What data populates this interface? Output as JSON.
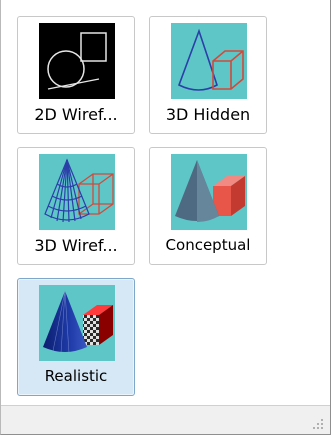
{
  "styles": [
    {
      "label": "2D Wiref..."
    },
    {
      "label": "3D Hidden"
    },
    {
      "label": "3D Wiref..."
    },
    {
      "label": "Conceptual"
    },
    {
      "label": "Realistic",
      "selected": true
    }
  ],
  "icons": {
    "grip": "resize-grip-icon"
  }
}
